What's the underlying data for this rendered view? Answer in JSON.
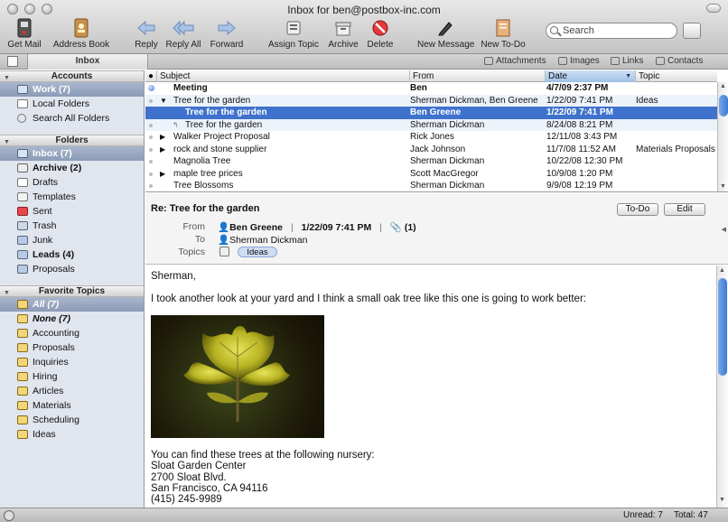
{
  "window": {
    "title": "Inbox for ben@postbox-inc.com"
  },
  "toolbar": {
    "get_mail": "Get Mail",
    "address_book": "Address Book",
    "reply": "Reply",
    "reply_all": "Reply All",
    "forward": "Forward",
    "assign_topic": "Assign Topic",
    "archive": "Archive",
    "delete": "Delete",
    "new_message": "New Message",
    "new_todo": "New To-Do",
    "search_placeholder": "Search"
  },
  "tabs": {
    "inbox": "Inbox",
    "attachments": "Attachments",
    "images": "Images",
    "links": "Links",
    "contacts": "Contacts"
  },
  "sidebar": {
    "accounts_header": "Accounts",
    "accounts": [
      {
        "label": "Work (7)",
        "icon": "inbox-tray-icon"
      },
      {
        "label": "Local Folders",
        "icon": "folder-icon"
      },
      {
        "label": "Search All Folders",
        "icon": "search-icon"
      }
    ],
    "folders_header": "Folders",
    "folders": [
      {
        "label": "Inbox (7)",
        "icon": "inbox-tray-icon"
      },
      {
        "label": "Archive (2)",
        "icon": "archive-box-icon"
      },
      {
        "label": "Drafts",
        "icon": "pencil-icon"
      },
      {
        "label": "Templates",
        "icon": "template-icon"
      },
      {
        "label": "Sent",
        "icon": "sent-icon"
      },
      {
        "label": "Trash",
        "icon": "trash-icon"
      },
      {
        "label": "Junk",
        "icon": "folder-icon"
      },
      {
        "label": "Leads (4)",
        "icon": "folder-icon"
      },
      {
        "label": "Proposals",
        "icon": "folder-icon"
      }
    ],
    "topics_header": "Favorite Topics",
    "topics": [
      {
        "label": "All (7)"
      },
      {
        "label": "None (7)"
      },
      {
        "label": "Accounting"
      },
      {
        "label": "Proposals"
      },
      {
        "label": "Inquiries"
      },
      {
        "label": "Hiring"
      },
      {
        "label": "Articles"
      },
      {
        "label": "Materials"
      },
      {
        "label": "Scheduling"
      },
      {
        "label": "Ideas"
      }
    ]
  },
  "list": {
    "columns": {
      "subject": "Subject",
      "from": "From",
      "date": "Date",
      "topic": "Topic"
    },
    "rows": [
      {
        "subject": "Meeting",
        "from": "Ben",
        "date": "4/7/09 2:37 PM",
        "topic": ""
      },
      {
        "subject": "Tree for the garden",
        "from": "Sherman Dickman, Ben Greene",
        "date": "1/22/09 7:41 PM",
        "topic": "Ideas"
      },
      {
        "subject": "Tree for the garden",
        "from": "Ben Greene",
        "date": "1/22/09 7:41 PM",
        "topic": ""
      },
      {
        "subject": "Tree for the garden",
        "from": "Sherman Dickman",
        "date": "8/24/08 8:21 PM",
        "topic": ""
      },
      {
        "subject": "Walker Project Proposal",
        "from": "Rick Jones",
        "date": "12/11/08 3:43 PM",
        "topic": ""
      },
      {
        "subject": "rock and stone supplier",
        "from": "Jack Johnson",
        "date": "11/7/08 11:52 AM",
        "topic": "Materials Proposals"
      },
      {
        "subject": "Magnolia Tree",
        "from": "Sherman Dickman",
        "date": "10/22/08 12:30 PM",
        "topic": ""
      },
      {
        "subject": "maple tree prices",
        "from": "Scott MacGregor",
        "date": "10/9/08 1:20 PM",
        "topic": ""
      },
      {
        "subject": "Tree Blossoms",
        "from": "Sherman Dickman",
        "date": "9/9/08 12:19 PM",
        "topic": ""
      }
    ]
  },
  "preview": {
    "subject": "Re: Tree for the garden",
    "todo_label": "To-Do",
    "edit_label": "Edit",
    "from_label": "From",
    "to_label": "To",
    "topics_label": "Topics",
    "from": "Ben Greene",
    "date": "1/22/09 7:41 PM",
    "attachments": "(1)",
    "to": "Sherman Dickman",
    "topic": "Ideas",
    "body": {
      "greeting": "Sherman,",
      "line1": "I took another look at your yard and I think a small oak tree like this one is going to work better:",
      "line2": "You can find these trees at the following nursery:",
      "address1": "Sloat Garden Center",
      "address2": "2700 Sloat Blvd.",
      "address3": "San Francisco, CA  94116",
      "phone": "(415) 245-9989"
    }
  },
  "status": {
    "unread": "Unread: 7",
    "total": "Total: 47"
  }
}
